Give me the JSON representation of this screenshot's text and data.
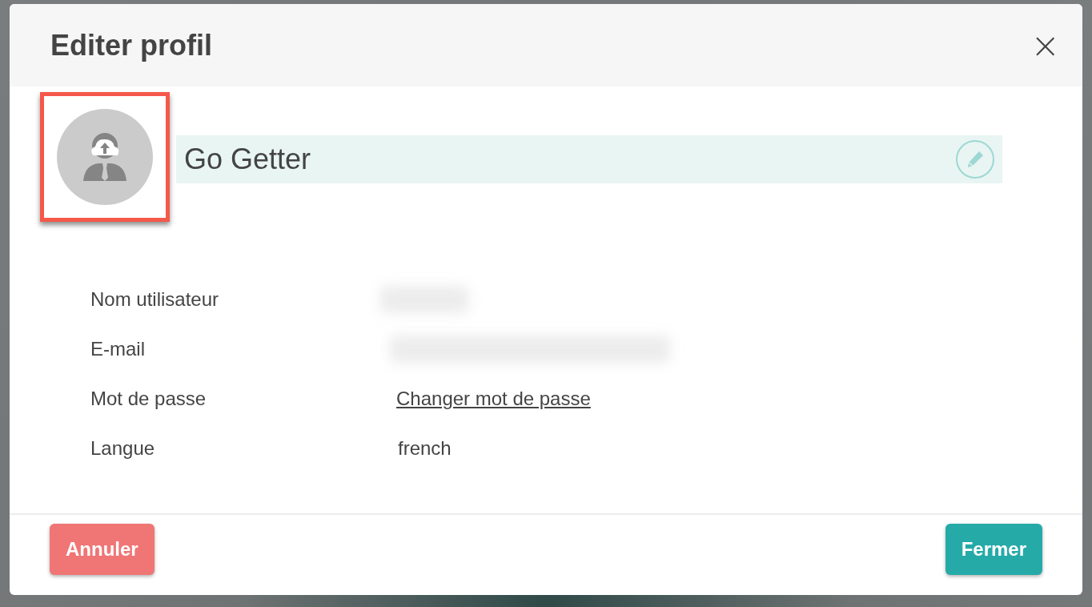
{
  "dialog": {
    "title": "Editer profil",
    "close": "×"
  },
  "profile": {
    "name": "Go Getter",
    "avatar_highlighted": true
  },
  "fields": [
    {
      "label": "Nom utilisateur",
      "kind": "redacted_short"
    },
    {
      "label": "E-mail",
      "kind": "redacted_long"
    },
    {
      "label": "Mot de passe",
      "kind": "link",
      "value": "Changer mot de passe"
    },
    {
      "label": "Langue",
      "kind": "text",
      "value": "french"
    }
  ],
  "buttons": [
    {
      "label": "Annuler",
      "kind": "cancel"
    },
    {
      "label": "Fermer",
      "kind": "primary"
    }
  ]
}
